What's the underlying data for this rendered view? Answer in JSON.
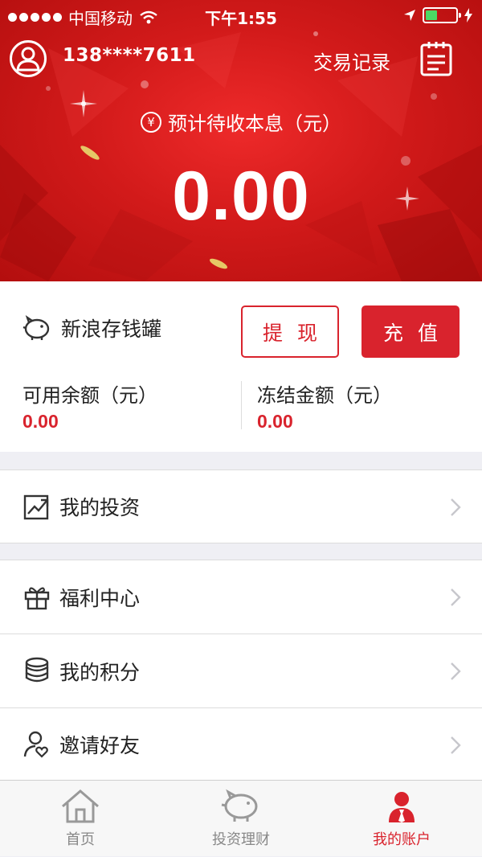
{
  "status_bar": {
    "carrier": "中国移动",
    "time": "下午1:55",
    "icons": [
      "signal-dots-icon",
      "wifi-icon",
      "location-arrow-icon",
      "battery-icon",
      "charging-bolt-icon"
    ]
  },
  "header": {
    "phone": "138****7611",
    "transaction_link": "交易记录",
    "subtitle": "预计待收本息（元）",
    "yen_symbol": "¥",
    "amount": "0.00"
  },
  "piggy_bank": {
    "name": "新浪存钱罐",
    "withdraw_button": "提现",
    "recharge_button": "充值",
    "available_label": "可用余额（元）",
    "available_value": "0.00",
    "frozen_label": "冻结金额（元）",
    "frozen_value": "0.00"
  },
  "menu": {
    "investments": "我的投资",
    "benefits": "福利中心",
    "points": "我的积分",
    "invite": "邀请好友"
  },
  "tabbar": {
    "home": "首页",
    "invest": "投资理财",
    "account": "我的账户"
  },
  "colors": {
    "brand_red": "#d9232d",
    "header_red": "#d21a1a",
    "battery_green": "#4cd964"
  }
}
